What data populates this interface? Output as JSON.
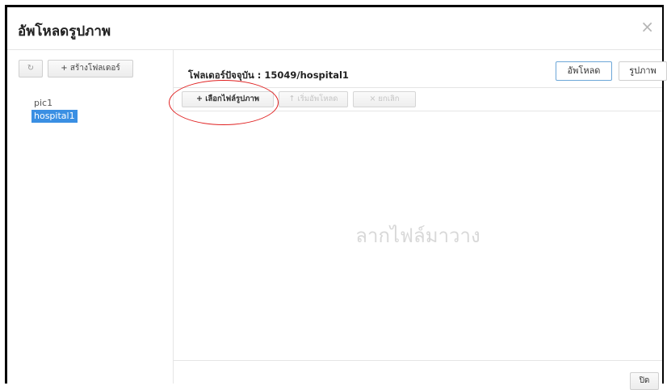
{
  "dialog": {
    "title": "อัพโหลดรูปภาพ",
    "close_icon_glyph": "×"
  },
  "sidebar": {
    "refresh_glyph": "↻",
    "new_folder_label": "+ สร้างโฟลเดอร์",
    "folders": [
      {
        "label": "pic1",
        "selected": false
      },
      {
        "label": "hospital1",
        "selected": true
      }
    ]
  },
  "main": {
    "current_folder": "โฟลเดอร์ปัจจุบัน : 15049/hospital1",
    "tabs": [
      {
        "label": "อัพโหลด",
        "active": true
      },
      {
        "label": "รูปภาพ",
        "active": false
      }
    ],
    "toolbar": {
      "select_files": "+ เลือกไฟล์รูปภาพ",
      "start_upload": "↑ เริ่มอัพโหลด",
      "cancel": "× ยกเลิก"
    },
    "drop_placeholder": "ลากไฟล์มาวาง"
  },
  "footer": {
    "close_label": "ปิด"
  },
  "colors": {
    "selected_folder_bg": "#3a8fe3",
    "annotation_circle": "#e02020"
  }
}
